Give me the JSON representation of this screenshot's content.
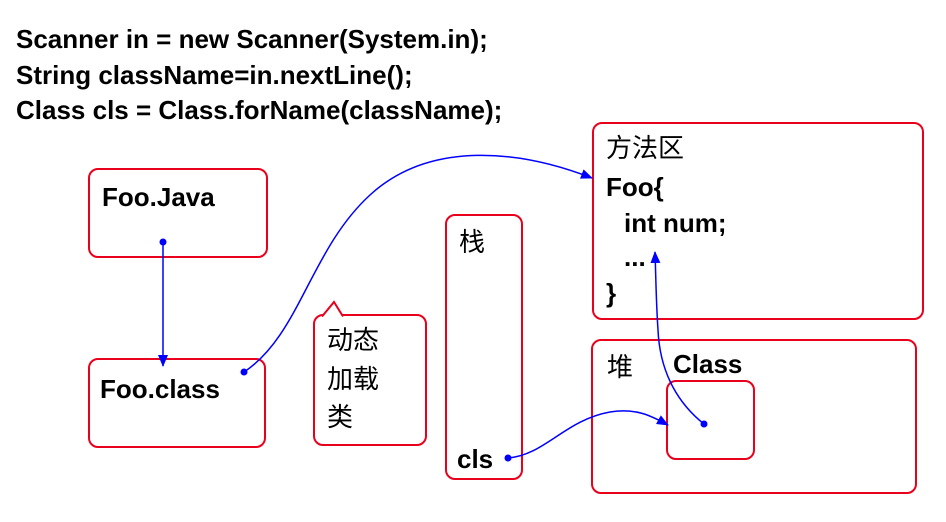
{
  "code": {
    "line1": "Scanner in = new Scanner(System.in);",
    "line2": "String className=in.nextLine();",
    "line3": "Class cls = Class.forName(className);"
  },
  "foo_java": {
    "label": "Foo.Java"
  },
  "foo_class": {
    "label": "Foo.class"
  },
  "callout": {
    "line1": "动态",
    "line2": "加载",
    "line3": "类"
  },
  "stack": {
    "title": "栈",
    "var": "cls"
  },
  "method_area": {
    "title": "方法区",
    "line1": "Foo{",
    "line2": "int num;",
    "line3": "...",
    "line4": "}"
  },
  "heap": {
    "title": "堆",
    "object_label": "Class"
  },
  "colors": {
    "box_border": "#e8001c",
    "arrow": "#0000ff"
  }
}
